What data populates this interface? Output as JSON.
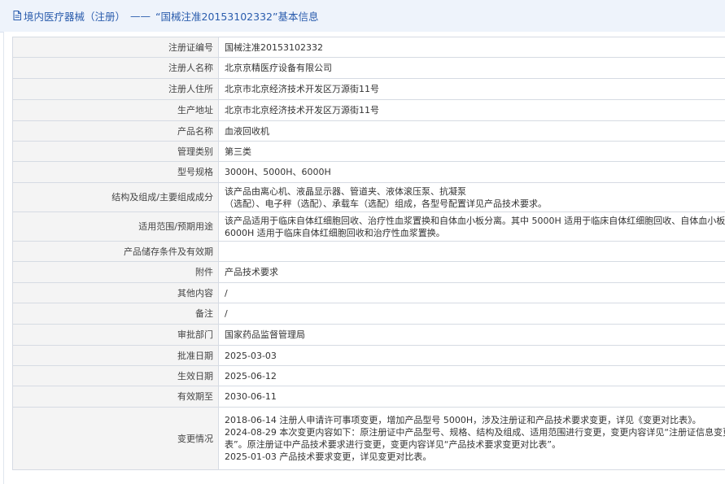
{
  "header": {
    "category": "境内医疗器械（注册）",
    "separator": "——",
    "title": "“国械注准20153102332”基本信息"
  },
  "rows": [
    {
      "label": "注册证编号",
      "lines": [
        "国械注准20153102332"
      ]
    },
    {
      "label": "注册人名称",
      "lines": [
        "北京京精医疗设备有限公司"
      ]
    },
    {
      "label": "注册人住所",
      "lines": [
        "北京市北京经济技术开发区万源街11号"
      ]
    },
    {
      "label": "生产地址",
      "lines": [
        "北京市北京经济技术开发区万源街11号"
      ]
    },
    {
      "label": "产品名称",
      "lines": [
        "血液回收机"
      ]
    },
    {
      "label": "管理类别",
      "lines": [
        "第三类"
      ]
    },
    {
      "label": "型号规格",
      "lines": [
        "3000H、5000H、6000H"
      ]
    },
    {
      "label": "结构及组成/主要组成成分",
      "lines": [
        "该产品由离心机、液晶显示器、管道夹、液体滚压泵、抗凝泵",
        "（选配）、电子秤（选配）、承载车（选配）组成，各型号配置详见产品技术要求。"
      ]
    },
    {
      "label": "适用范围/预期用途",
      "lines": [
        "该产品适用于临床自体红细胞回收、治疗性血浆置换和自体血小板分离。其中 5000H 适用于临床自体红细胞回收、自体血小板分离；",
        "6000H 适用于临床自体红细胞回收和治疗性血浆置换。"
      ]
    },
    {
      "label": "产品储存条件及有效期",
      "lines": [
        ""
      ]
    },
    {
      "label": "附件",
      "lines": [
        "产品技术要求"
      ]
    },
    {
      "label": "其他内容",
      "lines": [
        "/"
      ]
    },
    {
      "label": "备注",
      "lines": [
        "/"
      ]
    },
    {
      "label": "审批部门",
      "lines": [
        "国家药品监督管理局"
      ]
    },
    {
      "label": "批准日期",
      "lines": [
        "2025-03-03"
      ]
    },
    {
      "label": "生效日期",
      "lines": [
        "2025-06-12"
      ]
    },
    {
      "label": "有效期至",
      "lines": [
        "2030-06-11"
      ]
    },
    {
      "label": "变更情况",
      "lines": [
        "2018-06-14 注册人申请许可事项变更，增加产品型号 5000H，涉及注册证和产品技术要求变更，详见《变更对比表》。",
        "2024-08-29 本次变更内容如下：原注册证中产品型号、规格、结构及组成、适用范围进行变更，变更内容详见“注册证信息变更对比",
        "表”。原注册证中产品技术要求进行变更，变更内容详见“产品技术要求变更对比表”。",
        "2025-01-03 产品技术要求变更，详见变更对比表。"
      ]
    }
  ]
}
